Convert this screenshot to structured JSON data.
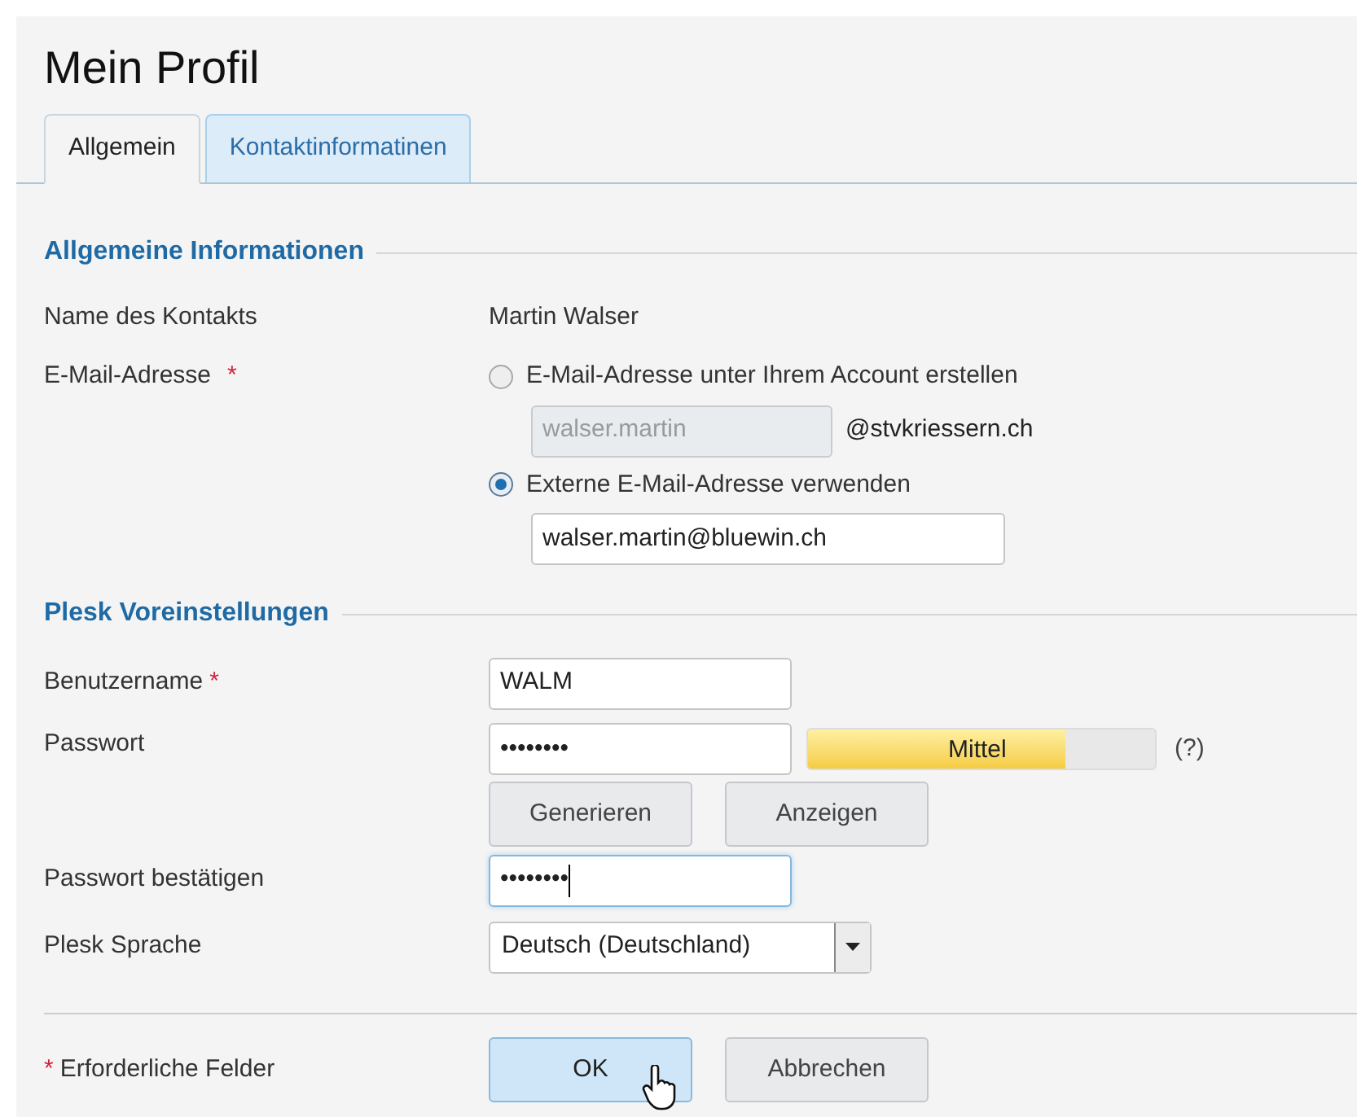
{
  "title": "Mein Profil",
  "tabs": [
    {
      "label": "Allgemein",
      "selected": true
    },
    {
      "label": "Kontaktinformatinen",
      "selected": false
    }
  ],
  "sections": [
    {
      "heading": "Allgemeine Informationen",
      "rows": [
        {
          "kind": "text",
          "label": "Name des Kontakts",
          "value": "Martin Walser"
        },
        {
          "kind": "email",
          "label": "E-Mail-Adresse",
          "required_mark": "*",
          "options": [
            {
              "label": "E-Mail-Adresse unter Ihrem Account erstellen",
              "selected": false,
              "field": {
                "value": "walser.martin",
                "disabled": true
              },
              "suffix": "@stvkriessern.ch"
            },
            {
              "label": "Externe E-Mail-Adresse verwenden",
              "selected": true,
              "field": {
                "value": "walser.martin@bluewin.ch",
                "disabled": false
              }
            }
          ]
        }
      ]
    },
    {
      "heading": "Plesk Voreinstellungen",
      "rows": [
        {
          "kind": "input",
          "label": "Benutzername",
          "required_mark": "*",
          "value": "WALM",
          "focused": false
        },
        {
          "kind": "password",
          "label": "Passwort",
          "value": "••••••••",
          "strength": {
            "label": "Mittel",
            "level": 0.74
          },
          "help": "(?)",
          "buttons": [
            "Generieren",
            "Anzeigen"
          ]
        },
        {
          "kind": "input",
          "label": "Passwort bestätigen",
          "value": "••••••••",
          "focused": true
        },
        {
          "kind": "select",
          "label": "Plesk Sprache",
          "value": "Deutsch (Deutschland)"
        }
      ]
    }
  ],
  "footer": {
    "required_mark": "*",
    "note": "Erforderliche Felder",
    "buttons": [
      {
        "label": "OK",
        "hovered": true
      },
      {
        "label": "Abbrechen",
        "hovered": false
      }
    ]
  }
}
